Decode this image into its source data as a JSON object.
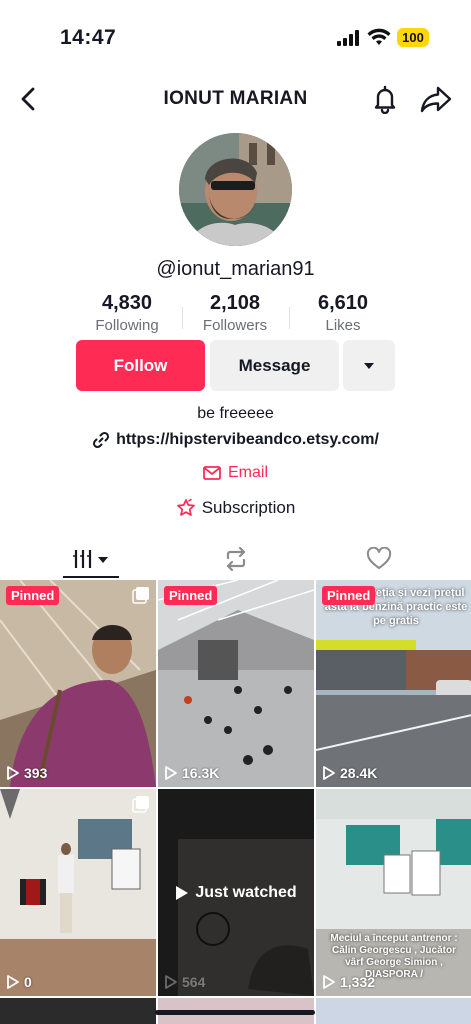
{
  "status_bar": {
    "time": "14:47",
    "battery": "100"
  },
  "header": {
    "title": "IONUT MARIAN"
  },
  "profile": {
    "username": "@ionut_marian91",
    "stats": [
      {
        "value": "4,830",
        "label": "Following"
      },
      {
        "value": "2,108",
        "label": "Followers"
      },
      {
        "value": "6,610",
        "label": "Likes"
      }
    ],
    "follow_label": "Follow",
    "message_label": "Message",
    "bio": "be freeeee",
    "link": "https://hipstervibeandco.etsy.com/",
    "email_label": "Email",
    "subscription_label": "Subscription"
  },
  "colors": {
    "accent": "#fe2c55",
    "text": "#161823",
    "muted": "#6b6e76",
    "button_bg": "#f0f0f1"
  },
  "tabs": [
    {
      "icon": "videos-grid-icon"
    },
    {
      "icon": "repost-icon"
    },
    {
      "icon": "liked-heart-icon"
    }
  ],
  "videos": [
    {
      "pinned": "Pinned",
      "views": "393",
      "caption": ""
    },
    {
      "pinned": "Pinned",
      "views": "16.3K",
      "caption": ""
    },
    {
      "pinned": "Pinned",
      "views": "28.4K",
      "caption": "vi din Elveția și vezi prețul asta la benzină practic este pe gratis"
    },
    {
      "pinned": "",
      "views": "0",
      "caption": ""
    },
    {
      "pinned": "",
      "views": "564",
      "caption": "",
      "watched": "Just watched"
    },
    {
      "pinned": "",
      "views": "1,332",
      "caption": "Meciul a început antrenor : Călin Georgescu , Jucător vârf George Simion , DIASPORA /"
    }
  ]
}
